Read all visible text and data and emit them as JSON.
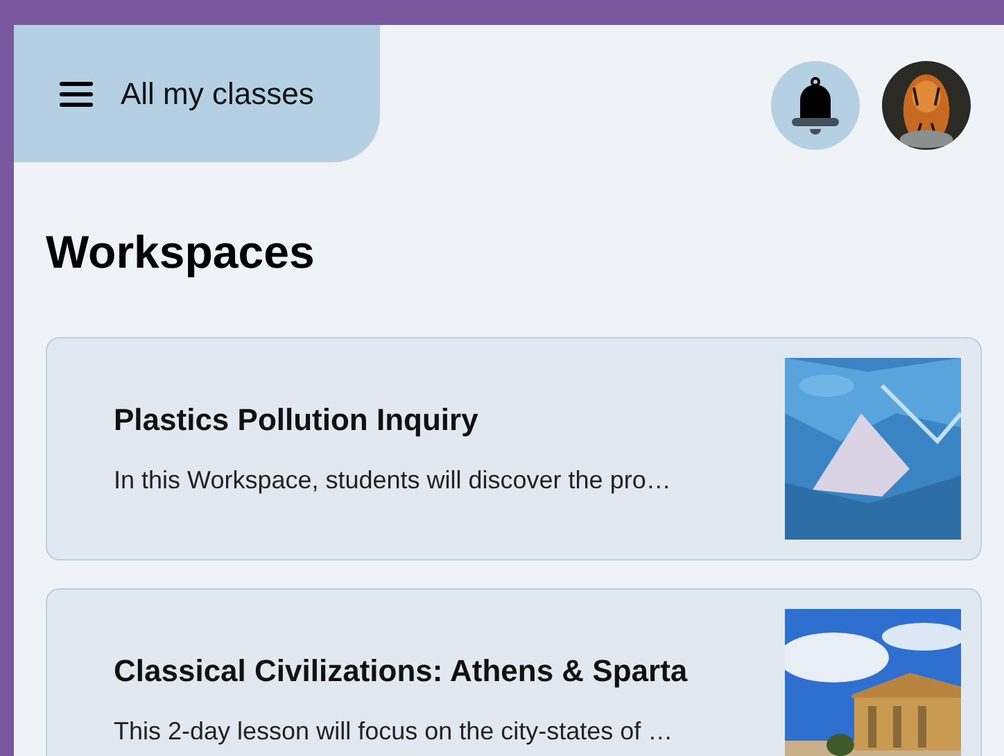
{
  "header": {
    "title": "All my classes"
  },
  "heading": "Workspaces",
  "workspaces": [
    {
      "title": "Plastics Pollution Inquiry",
      "description": "In this Workspace, students will discover the pro…"
    },
    {
      "title": "Classical Civilizations: Athens & Sparta",
      "description": "This 2-day lesson will focus on the city-states of …"
    }
  ]
}
